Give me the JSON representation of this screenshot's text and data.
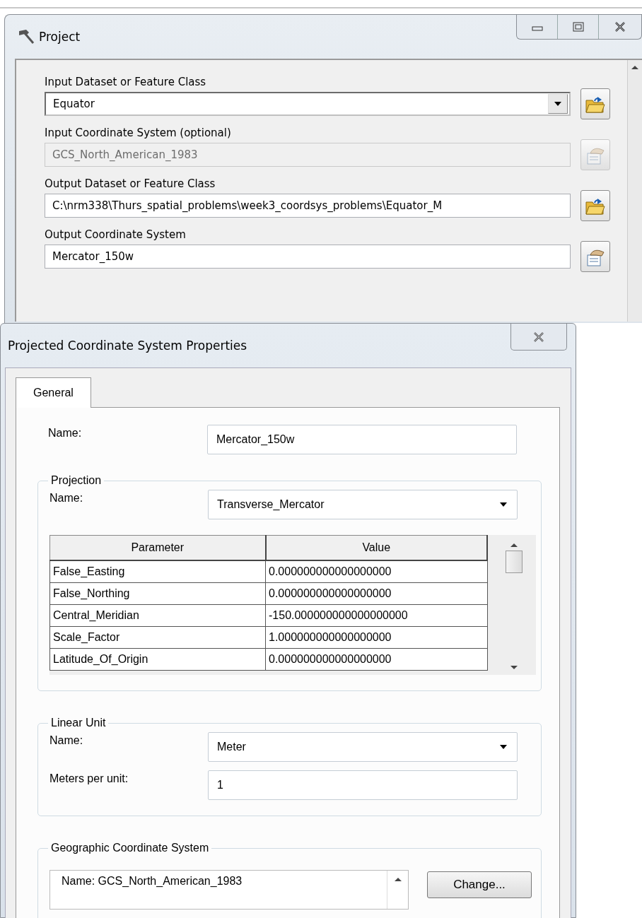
{
  "project_window": {
    "title": "Project",
    "fields": [
      {
        "label": "Input Dataset or Feature Class",
        "kind": "dropdown",
        "value": "Equator",
        "disabled": false,
        "button": {
          "kind": "folder"
        }
      },
      {
        "label": "Input Coordinate System (optional)",
        "kind": "text",
        "value": "GCS_North_American_1983",
        "disabled": true,
        "button": {
          "kind": "properties"
        }
      },
      {
        "label": "Output Dataset or Feature Class",
        "kind": "text",
        "value": "C:\\nrm338\\Thurs_spatial_problems\\week3_coordsys_problems\\Equator_M",
        "disabled": false,
        "button": {
          "kind": "folder"
        }
      },
      {
        "label": "Output Coordinate System",
        "kind": "text",
        "value": "Mercator_150w",
        "disabled": false,
        "button": {
          "kind": "properties"
        }
      }
    ]
  },
  "properties_dialog": {
    "title": "Projected Coordinate System Properties",
    "tabs": [
      {
        "label": "General",
        "selected": true
      }
    ],
    "name": {
      "label": "Name:",
      "value": "Mercator_150w"
    },
    "projection": {
      "legend": "Projection",
      "name_label": "Name:",
      "name_value": "Transverse_Mercator",
      "table": {
        "columns": [
          "Parameter",
          "Value"
        ],
        "rows": [
          [
            "False_Easting",
            "0.000000000000000000"
          ],
          [
            "False_Northing",
            "0.000000000000000000"
          ],
          [
            "Central_Meridian",
            "-150.000000000000000000"
          ],
          [
            "Scale_Factor",
            "1.000000000000000000"
          ],
          [
            "Latitude_Of_Origin",
            "0.000000000000000000"
          ]
        ]
      }
    },
    "linear_unit": {
      "legend": "Linear Unit",
      "name_label": "Name:",
      "name_value": "Meter",
      "meters_label": "Meters per unit:",
      "meters_value": "1"
    },
    "geographic": {
      "legend": "Geographic Coordinate System",
      "lines": [
        "Name: GCS_North_American_1983"
      ],
      "button": "Change..."
    }
  }
}
